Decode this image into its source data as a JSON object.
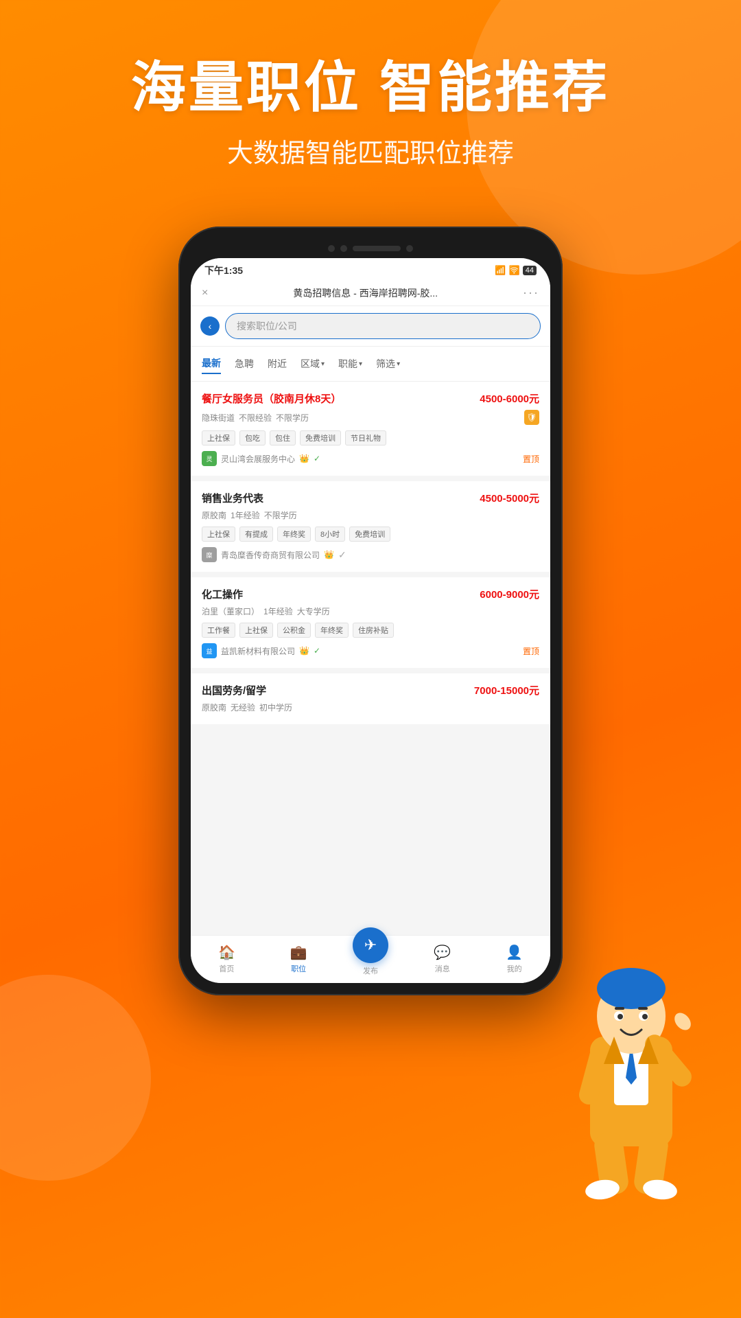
{
  "hero": {
    "title": "海量职位 智能推荐",
    "subtitle": "大数据智能匹配职位推荐"
  },
  "phone": {
    "status_bar": {
      "time": "下午1:35",
      "signal": "📶",
      "wifi": "🛜",
      "battery": "44"
    },
    "browser": {
      "title": "黄岛招聘信息 - 西海岸招聘网-胶...",
      "close_icon": "×",
      "menu_icon": "···"
    },
    "search": {
      "placeholder": "搜索职位/公司"
    },
    "filter_tabs": [
      {
        "label": "最新",
        "active": true
      },
      {
        "label": "急聘",
        "active": false
      },
      {
        "label": "附近",
        "active": false
      },
      {
        "label": "区域▾",
        "active": false
      },
      {
        "label": "职能▾",
        "active": false
      },
      {
        "label": "筛选▾",
        "active": false
      }
    ],
    "jobs": [
      {
        "title": "餐厅女服务员（胶南月休8天）",
        "salary": "4500-6000元",
        "location": "隐珠街道",
        "experience": "不限经验",
        "education": "不限学历",
        "tags": [
          "上社保",
          "包吃",
          "包住",
          "免费培训",
          "节日礼物"
        ],
        "company": "灵山湾会展服务中心",
        "pin": "置顶",
        "title_red": true,
        "has_shield": true
      },
      {
        "title": "销售业务代表",
        "salary": "4500-5000元",
        "location": "原胶南",
        "experience": "1年经验",
        "education": "不限学历",
        "tags": [
          "上社保",
          "有提成",
          "年终奖",
          "8小时",
          "免费培训"
        ],
        "company": "青岛糜香传奇商贸有限公司",
        "pin": "",
        "title_red": false,
        "has_shield": false
      },
      {
        "title": "化工操作",
        "salary": "6000-9000元",
        "location": "泊里（董家口）",
        "experience": "1年经验",
        "education": "大专学历",
        "tags": [
          "工作餐",
          "上社保",
          "公积金",
          "年终奖",
          "住房补贴"
        ],
        "company": "益凯新材料有限公司",
        "pin": "置顶",
        "title_red": false,
        "has_shield": false
      },
      {
        "title": "出国劳务/留学",
        "salary": "7000-15000元",
        "location": "原胶南",
        "experience": "无经验",
        "education": "初中学历",
        "tags": [],
        "company": "",
        "pin": "",
        "title_red": false,
        "has_shield": false
      }
    ],
    "bottom_nav": [
      {
        "icon": "🏠",
        "label": "首页",
        "active": false
      },
      {
        "icon": "💼",
        "label": "职位",
        "active": true
      },
      {
        "icon": "✈",
        "label": "发布",
        "active": false,
        "is_publish": true
      },
      {
        "icon": "💬",
        "label": "消息",
        "active": false
      },
      {
        "icon": "👤",
        "label": "我的",
        "active": false
      }
    ]
  }
}
